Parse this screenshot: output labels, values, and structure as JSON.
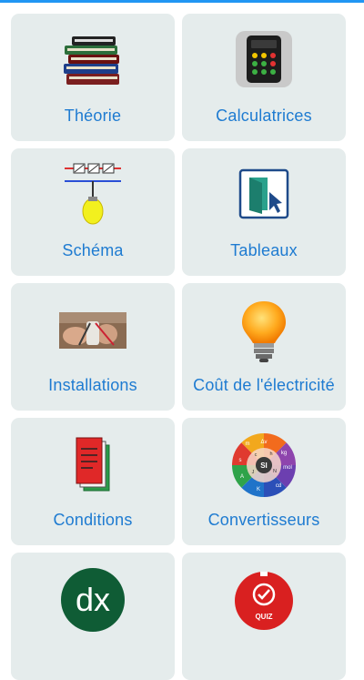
{
  "colors": {
    "accent": "#2196f3",
    "tile_bg": "#e5ecec",
    "label": "#1e7bd1"
  },
  "tiles": [
    {
      "label": "Théorie",
      "icon": "books-icon"
    },
    {
      "label": "Calculatrices",
      "icon": "calculator-icon"
    },
    {
      "label": "Schéma",
      "icon": "circuit-bulb-icon"
    },
    {
      "label": "Tableaux",
      "icon": "door-cursor-icon"
    },
    {
      "label": "Installations",
      "icon": "wiring-photo-icon"
    },
    {
      "label": "Coût de l'électricité",
      "icon": "lightbulb-icon"
    },
    {
      "label": "Conditions",
      "icon": "documents-icon"
    },
    {
      "label": "Convertisseurs",
      "icon": "si-units-wheel-icon"
    },
    {
      "label": "",
      "icon": "dx-icon"
    },
    {
      "label": "",
      "icon": "quiz-timer-icon"
    }
  ],
  "icon_text": {
    "dx": "dx",
    "quiz": "QUIZ",
    "si": "SI",
    "wheel": [
      "Δv",
      "kg",
      "mol",
      "cd",
      "K",
      "A",
      "s",
      "m",
      "h",
      "c",
      "N",
      "J"
    ]
  }
}
